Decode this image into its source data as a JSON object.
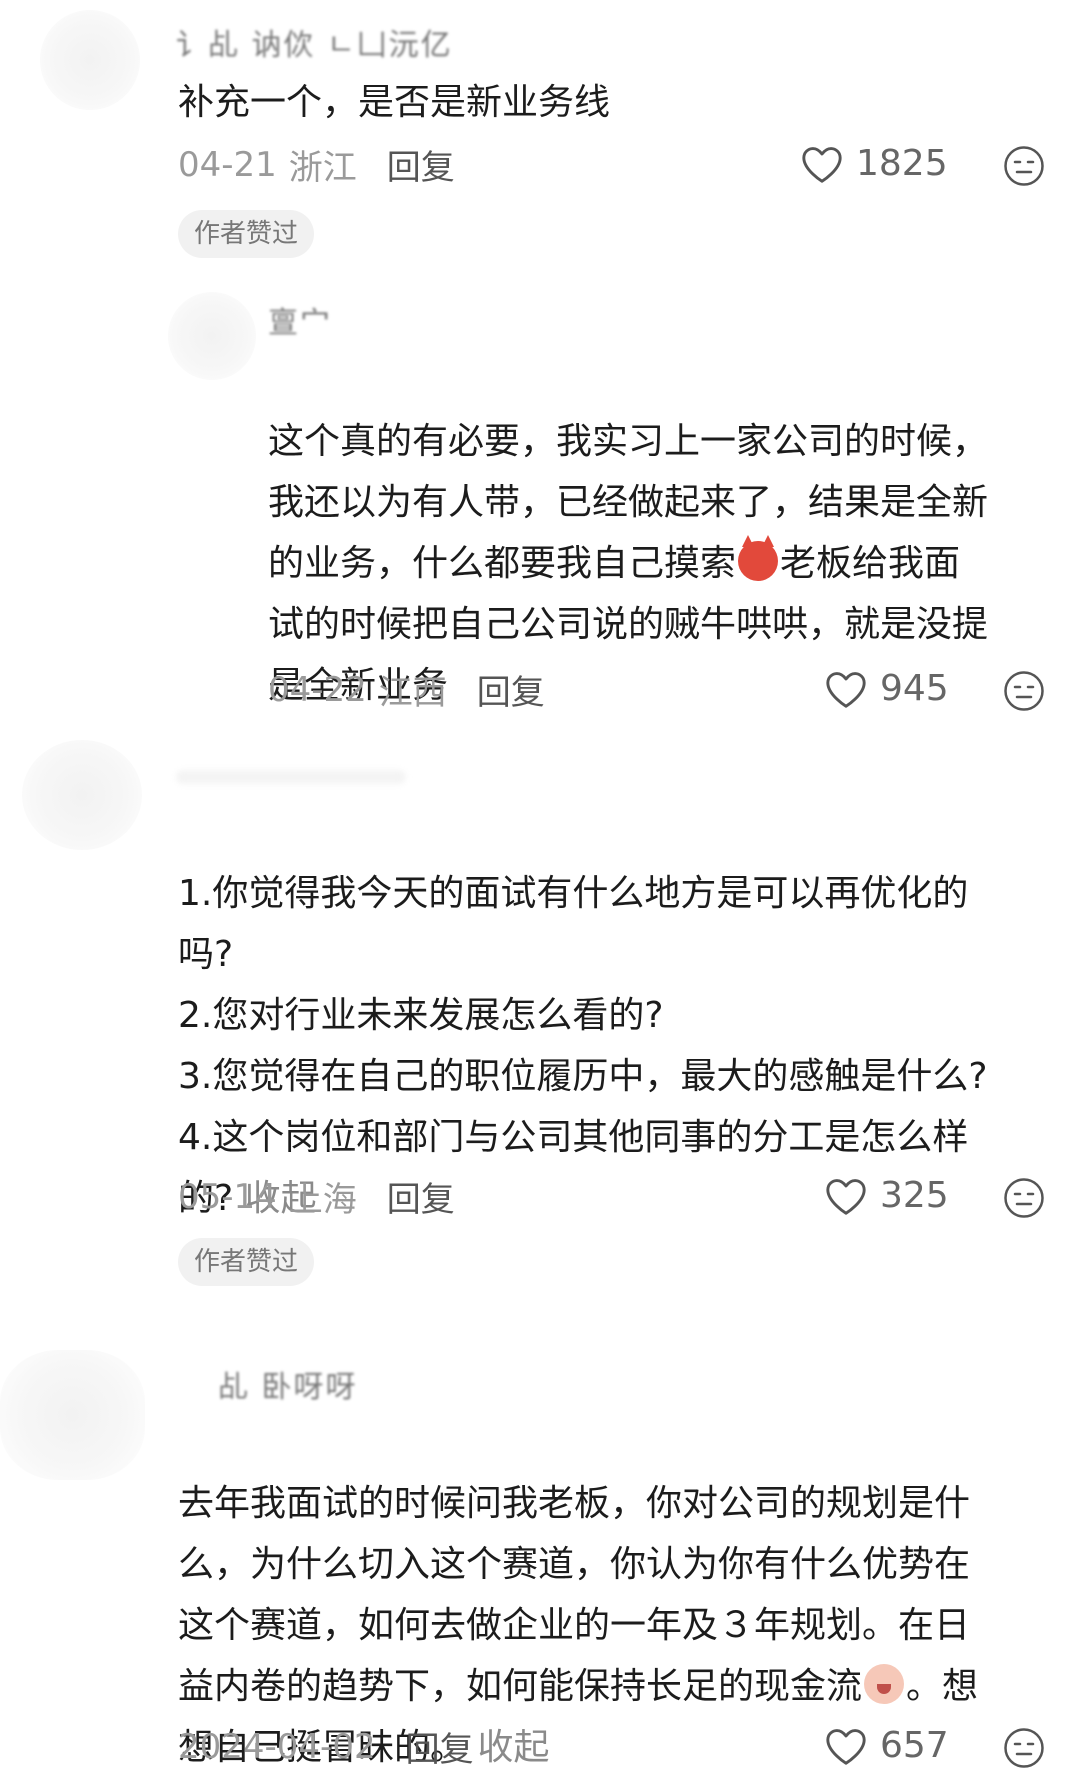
{
  "comments": [
    {
      "username": "讠乩 讷佽 ㄴ凵沅亿",
      "text": "补充一个，是否是新业务线",
      "date": "04-21",
      "location": "浙江",
      "reply": "回复",
      "likes": "1825",
      "badge": "作者赞过"
    },
    {
      "username": "亶宀",
      "text_part1": "这个真的有必要，我实习上一家公司的时候，\n我还以为有人带，已经做起来了，结果是全新\n的业务，什么都要我自己摸索",
      "emoji": "devil-emoji",
      "text_part2": "老板给我面\n试的时候把自己公司说的贼牛哄哄，就是没提\n是全新业务",
      "date": "04-22",
      "location": "江西",
      "reply": "回复",
      "likes": "945"
    },
    {
      "username": "",
      "text": "1.你觉得我今天的面试有什么地方是可以再优化的\n吗?\n2.您对行业未来发展怎么看的?\n3.您觉得在自己的职位履历中，最大的感触是什么?\n4.这个岗位和部门与公司其他同事的分工是怎么样\n的? ",
      "collapse": "收起",
      "date": "05-14",
      "location": "上海",
      "reply": "回复",
      "likes": "325",
      "badge": "作者赞过"
    },
    {
      "username": "乩 卧呀呀",
      "text_part1": "去年我面试的时候问我老板，你对公司的规划是什\n么，为什么切入这个赛道，你认为你有什么优势在\n这个赛道，如何去做企业的一年及３年规划。在日\n益内卷的趋势下，如何能保持长足的现金流",
      "emoji": "crying-emoji",
      "text_part2": "。想\n想自己挺冒昧的。 ",
      "collapse": "收起",
      "date": "2024-04-02",
      "reply": "回复",
      "likes": "657"
    }
  ],
  "icons": {
    "like": "heart-outline-icon",
    "reaction": "neutral-face-icon"
  },
  "colors": {
    "text": "#1c1c1c",
    "meta": "#9a9a9a",
    "badge_bg": "#f1f1f1"
  }
}
